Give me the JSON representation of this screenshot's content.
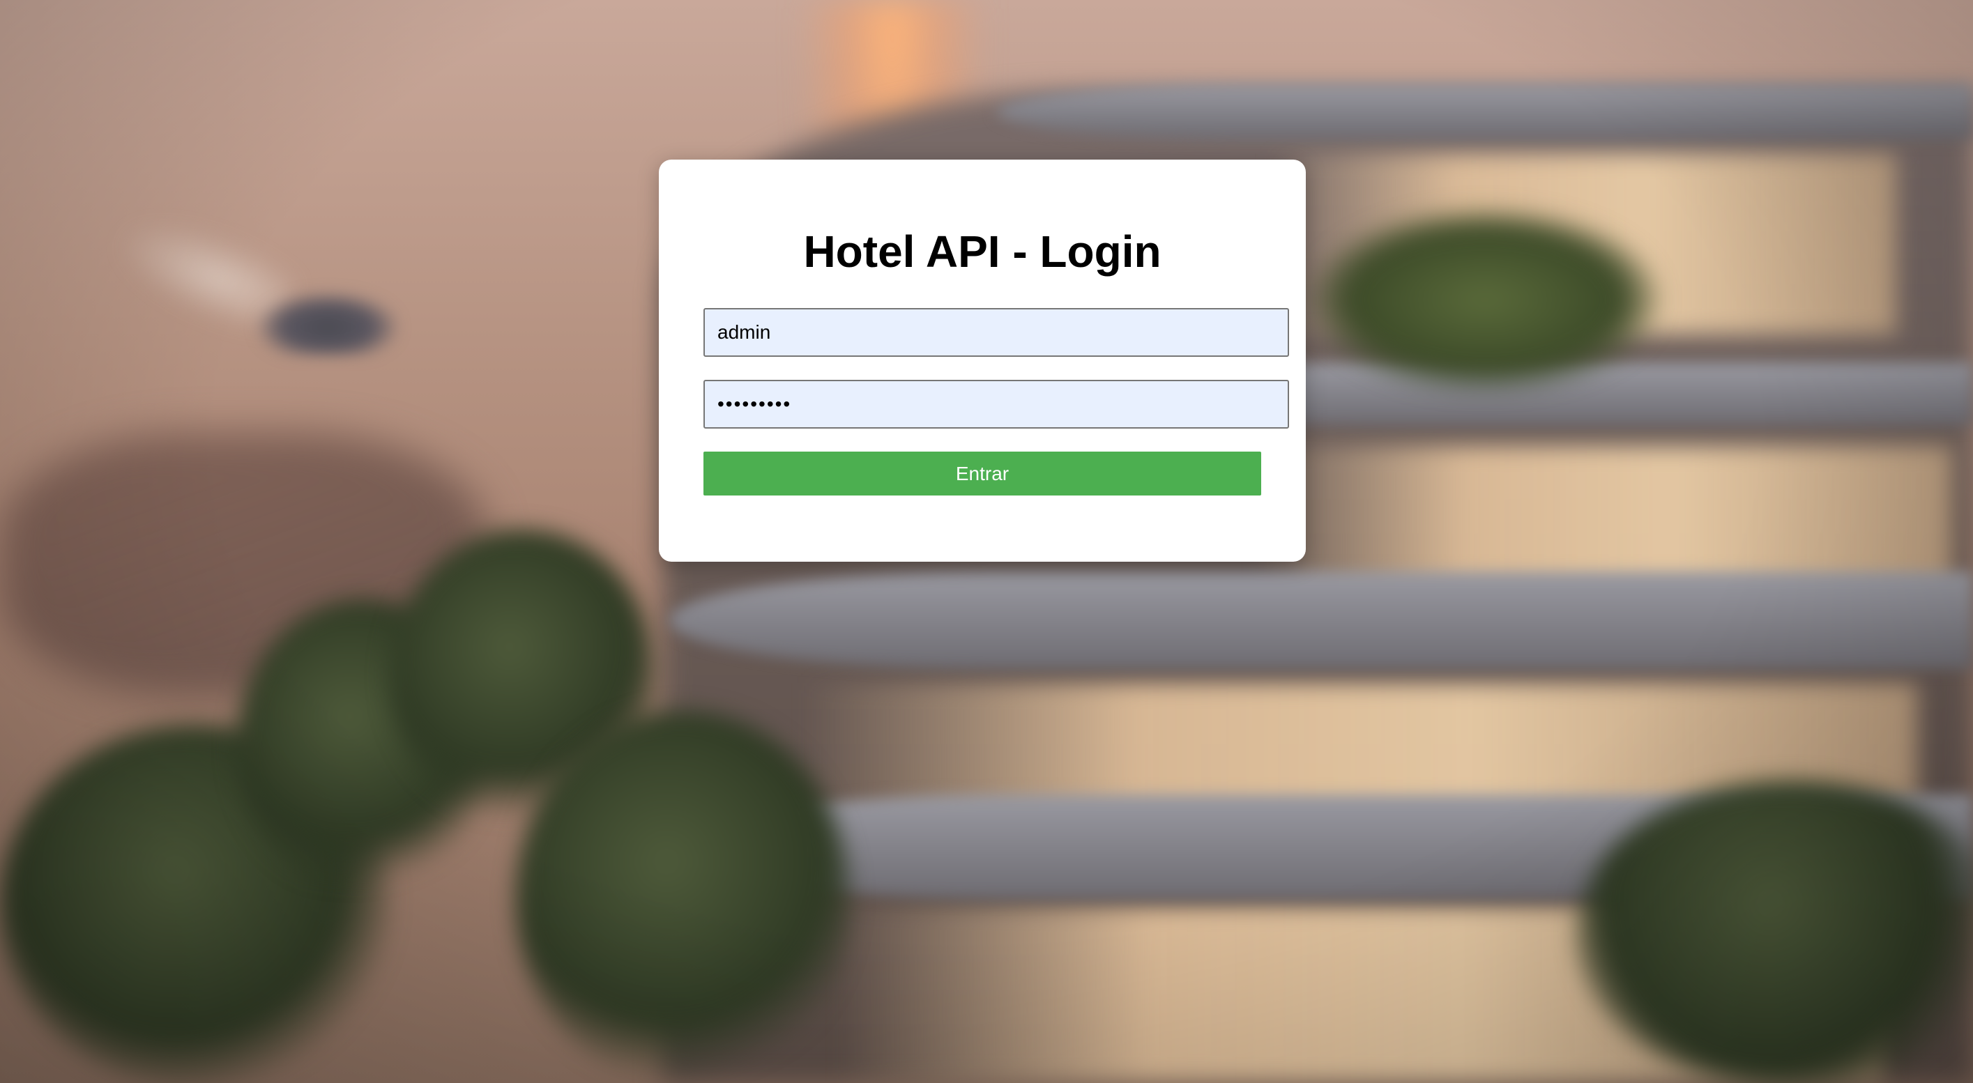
{
  "login": {
    "title": "Hotel API - Login",
    "username_value": "admin",
    "password_value": "adminpass",
    "submit_label": "Entrar"
  },
  "colors": {
    "button_bg": "#4caf50",
    "button_text": "#ffffff",
    "input_autofill_bg": "#e8f0fe",
    "card_bg": "#ffffff"
  }
}
